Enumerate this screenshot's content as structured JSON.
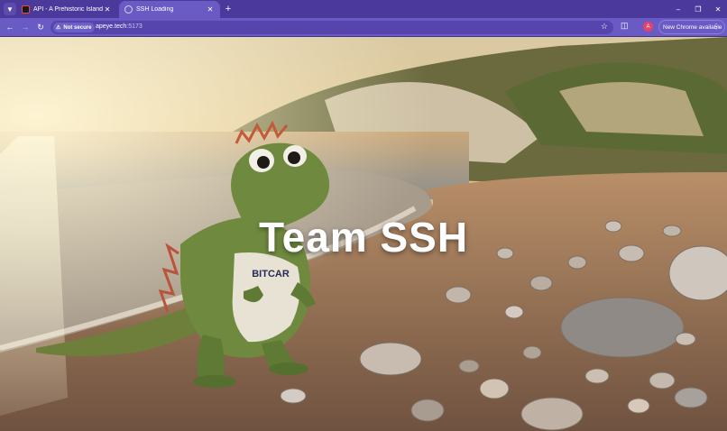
{
  "browser": {
    "tabs": [
      {
        "title": "API - A Prehistoric Island",
        "active": false
      },
      {
        "title": "SSH Loading",
        "active": true
      }
    ],
    "security_label": "Not secure",
    "url_host": "apeye.tech",
    "url_port": ":5173",
    "profile_initial": "A",
    "update_label": "New Chrome available",
    "icons": {
      "tab_search": "chevron-down-icon",
      "close": "close-icon",
      "new_tab": "plus-icon",
      "back": "back-arrow-icon",
      "forward": "forward-arrow-icon",
      "reload": "reload-icon",
      "warning": "warning-icon",
      "bookmark": "star-icon",
      "extensions": "extensions-icon",
      "menu": "more-vert-icon"
    },
    "colors": {
      "tab_strip": "#4b3a9c",
      "toolbar": "#6a5bc4",
      "omnibox": "#5545ad",
      "profile": "#e3436a"
    }
  },
  "page": {
    "headline": "Team SSH",
    "shirt_text": "BITCAR"
  }
}
